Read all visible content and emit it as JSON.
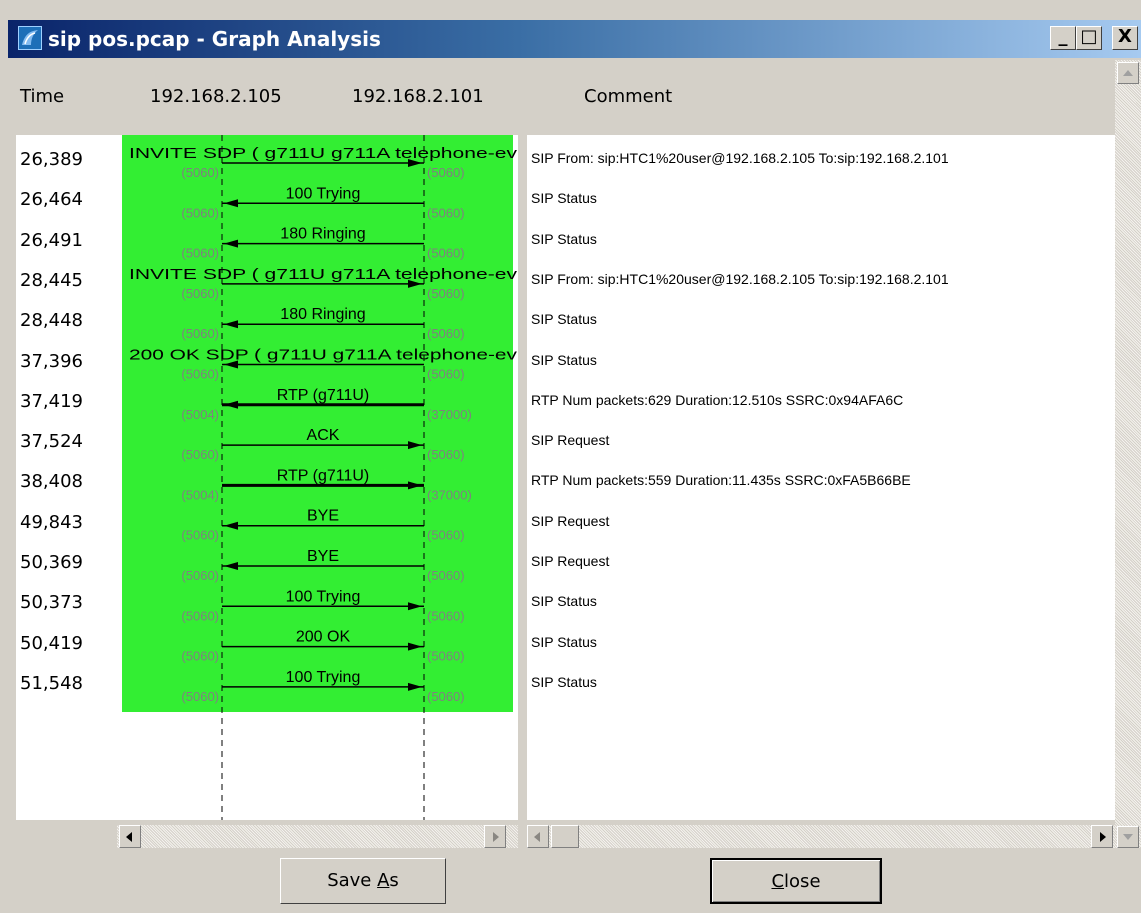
{
  "window": {
    "title": "sip pos.pcap - Graph Analysis",
    "buttons": {
      "minimize": "_",
      "maximize": "□",
      "close": "X"
    }
  },
  "headers": {
    "time": "Time",
    "host_a": "192.168.2.105",
    "host_b": "192.168.2.101",
    "comment": "Comment"
  },
  "rows": [
    {
      "time": "26,389",
      "label": "INVITE SDP ( g711U g711A telephone-ev",
      "dir": "right",
      "port_left": "(5060)",
      "port_right": "(5060)",
      "label_size": "large",
      "comment": "SIP From: sip:HTC1%20user@192.168.2.105 To:sip:192.168.2.101"
    },
    {
      "time": "26,464",
      "label": "100 Trying",
      "dir": "left",
      "port_left": "(5060)",
      "port_right": "(5060)",
      "comment": "SIP Status"
    },
    {
      "time": "26,491",
      "label": "180 Ringing",
      "dir": "left",
      "port_left": "(5060)",
      "port_right": "(5060)",
      "comment": "SIP Status"
    },
    {
      "time": "28,445",
      "label": "INVITE SDP ( g711U g711A telephone-ev",
      "dir": "right",
      "port_left": "(5060)",
      "port_right": "(5060)",
      "label_size": "large",
      "comment": "SIP From: sip:HTC1%20user@192.168.2.105 To:sip:192.168.2.101"
    },
    {
      "time": "28,448",
      "label": "180 Ringing",
      "dir": "left",
      "port_left": "(5060)",
      "port_right": "(5060)",
      "comment": "SIP Status"
    },
    {
      "time": "37,396",
      "label": "200 OK SDP ( g711U g711A telephone-ev",
      "dir": "left",
      "port_left": "(5060)",
      "port_right": "(5060)",
      "label_size": "large",
      "comment": "SIP Status"
    },
    {
      "time": "37,419",
      "label": "RTP (g711U)",
      "dir": "left",
      "port_left": "(5004)",
      "port_right": "(37000)",
      "thick": true,
      "comment": "RTP Num packets:629  Duration:12.510s SSRC:0x94AFA6C"
    },
    {
      "time": "37,524",
      "label": "ACK",
      "dir": "right",
      "port_left": "(5060)",
      "port_right": "(5060)",
      "comment": "SIP Request"
    },
    {
      "time": "38,408",
      "label": "RTP (g711U)",
      "dir": "right",
      "port_left": "(5004)",
      "port_right": "(37000)",
      "thick": true,
      "comment": "RTP Num packets:559  Duration:11.435s SSRC:0xFA5B66BE"
    },
    {
      "time": "49,843",
      "label": "BYE",
      "dir": "left",
      "port_left": "(5060)",
      "port_right": "(5060)",
      "comment": "SIP Request"
    },
    {
      "time": "50,369",
      "label": "BYE",
      "dir": "left",
      "port_left": "(5060)",
      "port_right": "(5060)",
      "comment": "SIP Request"
    },
    {
      "time": "50,373",
      "label": "100 Trying",
      "dir": "right",
      "port_left": "(5060)",
      "port_right": "(5060)",
      "comment": "SIP Status"
    },
    {
      "time": "50,419",
      "label": "200 OK",
      "dir": "right",
      "port_left": "(5060)",
      "port_right": "(5060)",
      "comment": "SIP Status"
    },
    {
      "time": "51,548",
      "label": "100 Trying",
      "dir": "right",
      "port_left": "(5060)",
      "port_right": "(5060)",
      "comment": "SIP Status"
    }
  ],
  "colors": {
    "highlight": "#33ee33",
    "port_text": "#808080",
    "titlebar_start": "#0a246a",
    "titlebar_end": "#a6caf0"
  },
  "footer": {
    "save_as_pre": "Save ",
    "save_as_mnemonic": "A",
    "save_as_post": "s",
    "close_mnemonic": "C",
    "close_post": "lose"
  }
}
